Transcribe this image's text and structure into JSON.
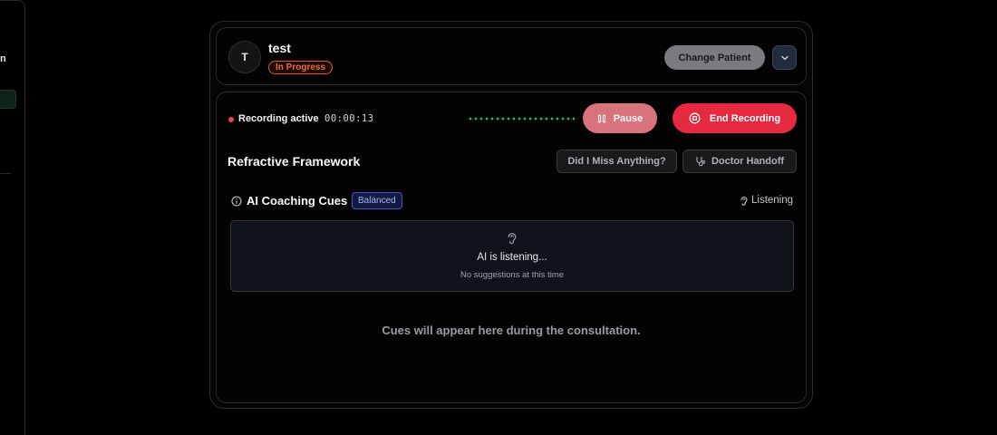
{
  "sidebar": {
    "fragment": "n"
  },
  "patient": {
    "initial": "T",
    "name": "test",
    "status": "In Progress",
    "change_label": "Change Patient"
  },
  "recording": {
    "status_label": "Recording active",
    "elapsed": "00:00:13",
    "pause_label": "Pause",
    "end_label": "End Recording"
  },
  "framework": {
    "title": "Refractive Framework",
    "miss_label": "Did I Miss Anything?",
    "handoff_label": "Doctor Handoff"
  },
  "cues": {
    "title": "AI Coaching Cues",
    "mode_badge": "Balanced",
    "listen_status": "Listening",
    "box_title": "AI is listening...",
    "box_subtitle": "No suggestions at this time",
    "empty_message": "Cues will appear here during the consultation."
  },
  "colors": {
    "accent_red": "#e5293f",
    "pause_pink": "#d9737e",
    "waveform_green": "#22c55e",
    "badge_orange": "#f26b3a",
    "badge_blue": "#4756c4"
  },
  "icons": {
    "chevron": "chevron-down-icon",
    "pause": "pause-icon",
    "stop": "stop-circle-icon",
    "stethoscope": "stethoscope-icon",
    "info": "info-icon",
    "ear": "ear-icon"
  }
}
